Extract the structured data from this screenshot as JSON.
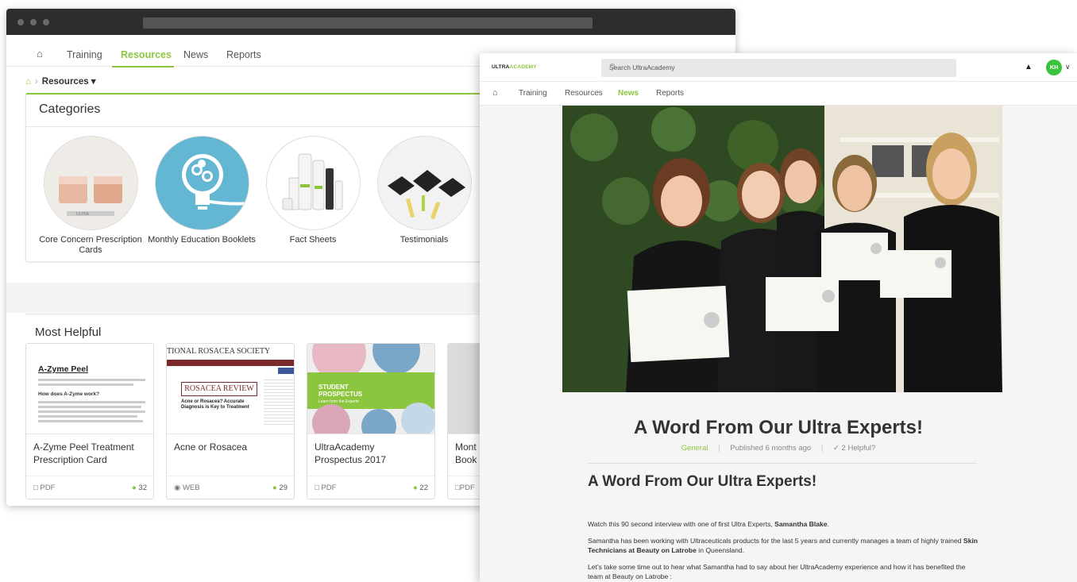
{
  "back_window": {
    "nav": {
      "home_icon": "home-icon",
      "training": "Training",
      "resources": "Resources",
      "news": "News",
      "reports": "Reports"
    },
    "breadcrumb": {
      "home_icon": "home-icon",
      "current": "Resources ▾"
    },
    "categories": {
      "title": "Categories",
      "items": [
        {
          "label": "Core Concern Prescription Cards"
        },
        {
          "label": "Monthly Education Booklets"
        },
        {
          "label": "Fact Sheets"
        },
        {
          "label": "Testimonials"
        }
      ]
    },
    "most_helpful": {
      "title": "Most Helpful",
      "cards": [
        {
          "title": "A-Zyme Peel Treatment Prescription Card",
          "type": "PDF",
          "count": "32",
          "thumb_heading": "A-Zyme Peel",
          "thumb_sub": "How does A-Zyme work?"
        },
        {
          "title": "Acne or Rosacea",
          "type": "WEB",
          "count": "29",
          "thumb_heading": "TIONAL ROSACEA SOCIETY",
          "thumb_sub": "ROSACEA REVIEW",
          "thumb_text": "Acne or Rosacea? Accurate Diagnosis is Key to Treatment"
        },
        {
          "title": "UltraAcademy Prospectus 2017",
          "type": "PDF",
          "count": "22",
          "thumb_heading": "STUDENT PROSPECTUS",
          "thumb_sub": "Learn from the Experts"
        },
        {
          "title": "Mont Book",
          "type": "PDF",
          "count": ""
        }
      ]
    }
  },
  "front_window": {
    "logo": {
      "ultra": "ULTRA",
      "academy": "ACADEMY"
    },
    "search": {
      "placeholder": "Search UltraAcademy"
    },
    "avatar": "KH",
    "nav": {
      "training": "Training",
      "resources": "Resources",
      "news": "News",
      "reports": "Reports"
    },
    "article": {
      "title": "A Word From Our Ultra Experts!",
      "category": "General",
      "published": "Published 6 months ago",
      "helpful": "2 Helpful?",
      "heading": "A Word From Our Ultra Experts!",
      "p1_pre": "Watch this 90 second interview with one of first Ultra Experts, ",
      "p1_bold": "Samantha Blake",
      "p1_post": ".",
      "p2_pre": "Samantha has been working with Ultraceuticals products for the last 5 years and currently manages a team of highly trained ",
      "p2_bold": "Skin Technicians at Beauty on Latrobe",
      "p2_post": " in Queensland.",
      "p3": "Let's take some time out to hear what Samantha had to say about her UltraAcademy experience and how it has benefited the team at Beauty on Latrobe :"
    }
  },
  "colors": {
    "accent": "#8cc63f",
    "titlebar": "#2d2d2d",
    "avatar": "#3bc33b"
  }
}
